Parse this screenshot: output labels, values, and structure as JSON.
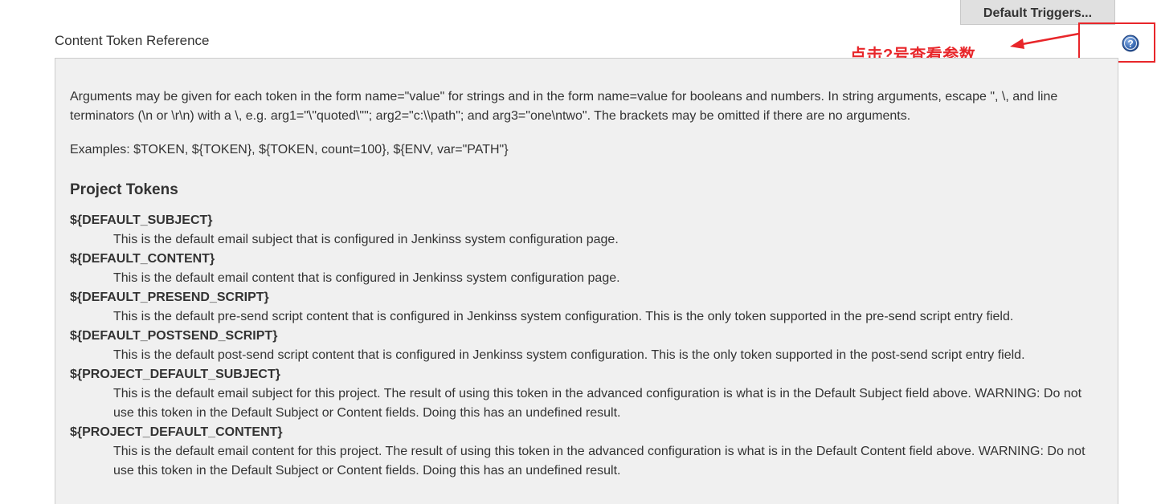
{
  "toolbar": {
    "default_triggers_label": "Default Triggers..."
  },
  "section": {
    "label": "Content Token Reference"
  },
  "annotation": {
    "text": "点击?号查看参数",
    "color": "#e8262a"
  },
  "help_icon": {
    "name": "question-mark-help-icon",
    "glyph": "?",
    "color": "#2e5a9e"
  },
  "help": {
    "intro": "Arguments may be given for each token in the form name=\"value\" for strings and in the form name=value for booleans and numbers. In string arguments, escape \", \\, and line terminators (\\n or \\r\\n) with a \\, e.g. arg1=\"\\\"quoted\\\"\"; arg2=\"c:\\\\path\"; and arg3=\"one\\ntwo\". The brackets may be omitted if there are no arguments.",
    "examples": "Examples: $TOKEN, ${TOKEN}, ${TOKEN, count=100}, ${ENV, var=\"PATH\"}",
    "project_tokens_heading": "Project Tokens",
    "tokens": [
      {
        "name": "${DEFAULT_SUBJECT}",
        "desc": "This is the default email subject that is configured in Jenkinss system configuration page."
      },
      {
        "name": "${DEFAULT_CONTENT}",
        "desc": "This is the default email content that is configured in Jenkinss system configuration page."
      },
      {
        "name": "${DEFAULT_PRESEND_SCRIPT}",
        "desc": "This is the default pre-send script content that is configured in Jenkinss system configuration. This is the only token supported in the pre-send script entry field."
      },
      {
        "name": "${DEFAULT_POSTSEND_SCRIPT}",
        "desc": "This is the default post-send script content that is configured in Jenkinss system configuration. This is the only token supported in the post-send script entry field."
      },
      {
        "name": "${PROJECT_DEFAULT_SUBJECT}",
        "desc": "This is the default email subject for this project. The result of using this token in the advanced configuration is what is in the Default Subject field above. WARNING: Do not use this token in the Default Subject or Content fields. Doing this has an undefined result."
      },
      {
        "name": "${PROJECT_DEFAULT_CONTENT}",
        "desc": "This is the default email content for this project. The result of using this token in the advanced configuration is what is in the Default Content field above. WARNING: Do not use this token in the Default Subject or Content fields. Doing this has an undefined result."
      }
    ]
  }
}
